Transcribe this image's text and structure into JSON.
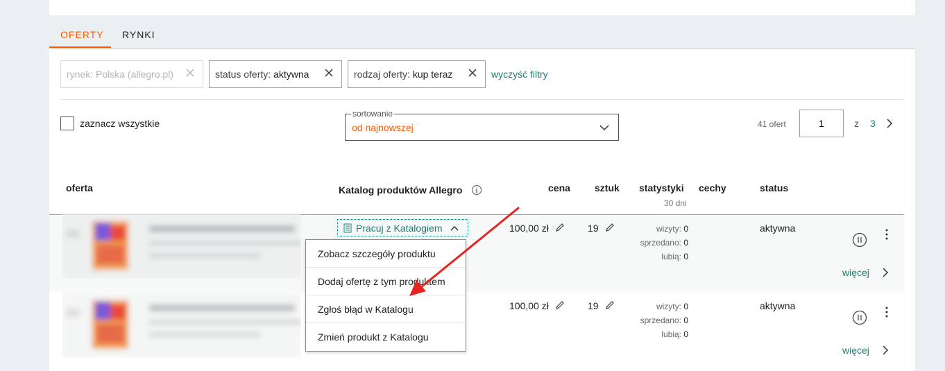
{
  "tabs": [
    {
      "label": "OFERTY",
      "active": true
    },
    {
      "label": "RYNKI",
      "active": false
    }
  ],
  "filters": {
    "market": "rynek: Polska (allegro.pl)",
    "status_key": "status oferty:",
    "status_value": "aktywna",
    "type_key": "rodzaj oferty:",
    "type_value": "kup teraz",
    "clear": "wyczyść filtry"
  },
  "toolbar": {
    "select_all": "zaznacz wszystkie",
    "sort_legend": "sortowanie",
    "sort_value": "od najnowszej",
    "count": "41 ofert",
    "page": "1",
    "of": "z",
    "total_pages": "3"
  },
  "columns": {
    "offer": "oferta",
    "catalog": "Katalog produktów Allegro",
    "price": "cena",
    "qty": "sztuk",
    "stats": "statystyki",
    "stats_sub": "30 dni",
    "features": "cechy",
    "status": "status"
  },
  "catalog_button": "Pracuj z Katalogiem",
  "rows": [
    {
      "price": "100,00 zł",
      "qty": "19",
      "visits_label": "wizyty:",
      "visits": "0",
      "sold_label": "sprzedano:",
      "sold": "0",
      "likes_label": "lubią:",
      "likes": "0",
      "status": "aktywna",
      "more": "więcej"
    },
    {
      "price": "100,00 zł",
      "qty": "19",
      "visits_label": "wizyty:",
      "visits": "0",
      "sold_label": "sprzedano:",
      "sold": "0",
      "likes_label": "lubią:",
      "likes": "0",
      "status": "aktywna",
      "more": "więcej"
    }
  ],
  "dropdown": [
    "Zobacz szczegóły produktu",
    "Dodaj ofertę z tym produktem",
    "Zgłoś błąd w Katalogu",
    "Zmień produkt z Katalogu"
  ],
  "colors": {
    "accent": "#ff5a00",
    "link": "#1a7f72",
    "annotation_arrow": "#e8231f"
  }
}
